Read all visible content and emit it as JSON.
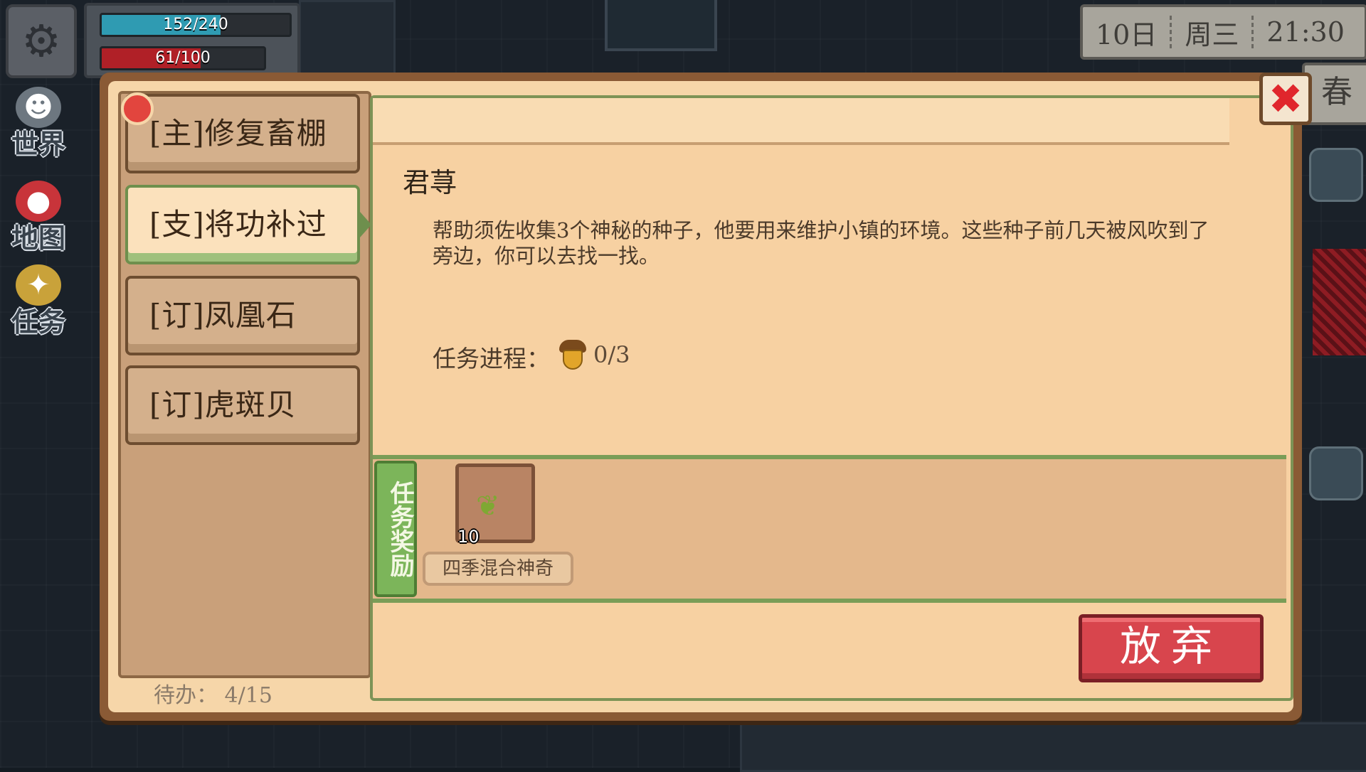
{
  "hud": {
    "hp_text": "152/240",
    "hp_fraction": 0.633,
    "energy_text": "61/100",
    "energy_fraction": 0.61,
    "settings_icon": "gear-icon",
    "side_buttons": [
      {
        "label": "世界",
        "icon": "world-icon"
      },
      {
        "label": "地图",
        "icon": "map-pin-icon"
      },
      {
        "label": "任务",
        "icon": "quest-icon"
      }
    ]
  },
  "date": {
    "day": "10日",
    "weekday": "周三",
    "time": "21:30",
    "season": "春"
  },
  "quests": {
    "tabs": [
      {
        "label": "[主]修复畜棚",
        "active": false
      },
      {
        "label": "[支]将功补过",
        "active": true
      },
      {
        "label": "[订]凤凰石",
        "active": false
      },
      {
        "label": "[订]虎斑贝",
        "active": false
      }
    ],
    "pending_label": "待办：",
    "pending_value": "4/15"
  },
  "detail": {
    "giver": "君荨",
    "description": "帮助须佐收集3个神秘的种子，他要用来维护小镇的环境。这些种子前几天被风吹到了旁边，你可以去找一找。",
    "progress_label": "任务进程：",
    "progress_icon": "acorn-icon",
    "progress_value": "0/3",
    "reward_tab_label": "任务奖励",
    "reward": {
      "count": "10",
      "name": "四季混合神奇",
      "icon": "seeds-icon"
    },
    "abandon_label": "放弃"
  },
  "colors": {
    "hp_bar": "#2f9bb2",
    "energy_bar": "#b02027",
    "abandon_button": "#d8454d",
    "reward_tab": "#7cb55a",
    "close_x": "#e0262c"
  }
}
